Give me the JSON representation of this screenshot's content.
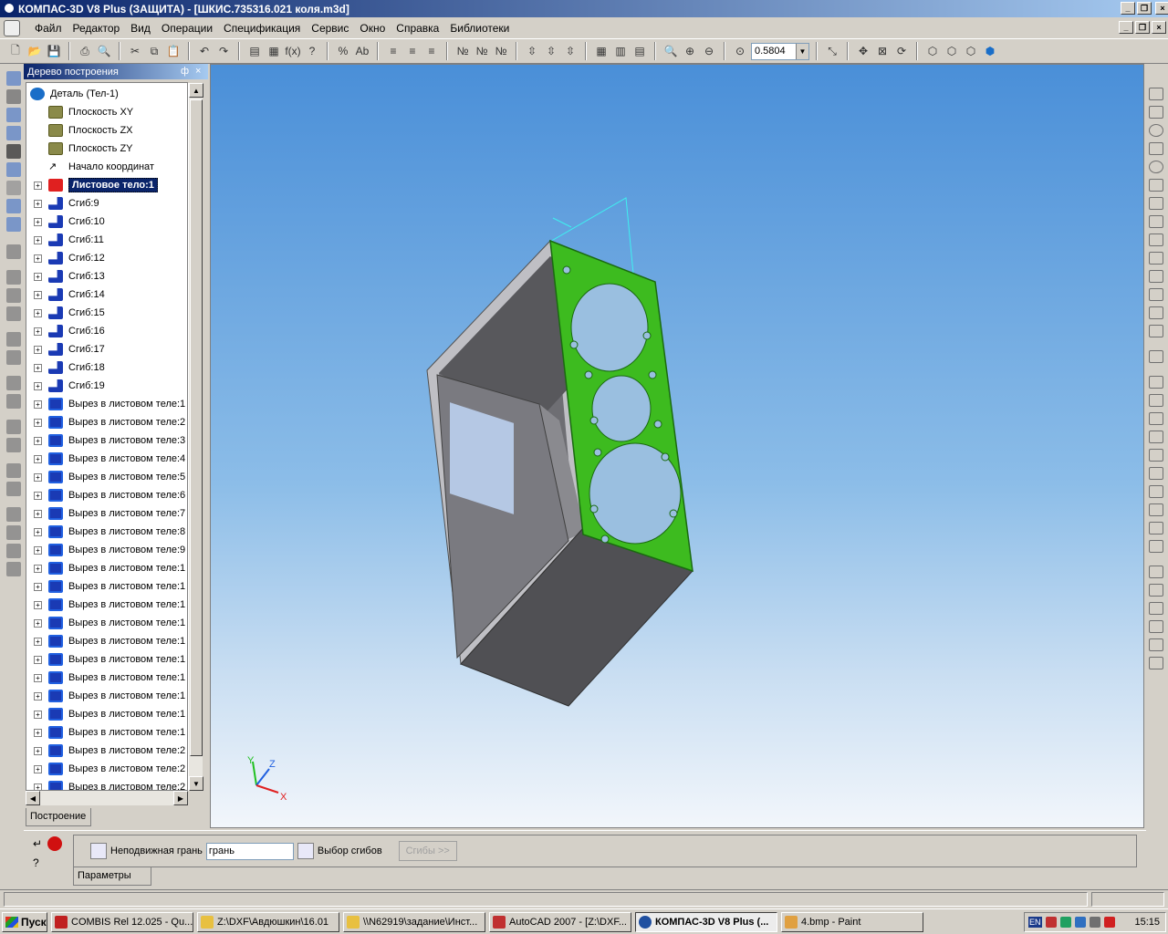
{
  "window": {
    "title": "КОМПАС-3D V8 Plus (ЗАЩИТА) - [ШКИС.735316.021 коля.m3d]"
  },
  "menu": [
    "Файл",
    "Редактор",
    "Вид",
    "Операции",
    "Спецификация",
    "Сервис",
    "Окно",
    "Справка",
    "Библиотеки"
  ],
  "toolbar": {
    "zoom_value": "0.5804"
  },
  "tree": {
    "title": "Дерево построения",
    "pin": "ф",
    "close": "×",
    "root": "Деталь (Тел-1)",
    "items": [
      {
        "label": "Плоскость XY",
        "icon": "plane-icon",
        "expandable": false
      },
      {
        "label": "Плоскость ZX",
        "icon": "plane-icon",
        "expandable": false
      },
      {
        "label": "Плоскость ZY",
        "icon": "plane-icon",
        "expandable": false
      },
      {
        "label": "Начало координат",
        "icon": "origin-icon",
        "expandable": false
      },
      {
        "label": "Листовое тело:1",
        "icon": "sheet-body-icon",
        "expandable": true,
        "selected": true
      },
      {
        "label": "Сгиб:9",
        "icon": "bend-icon",
        "expandable": true
      },
      {
        "label": "Сгиб:10",
        "icon": "bend-icon",
        "expandable": true
      },
      {
        "label": "Сгиб:11",
        "icon": "bend-icon",
        "expandable": true
      },
      {
        "label": "Сгиб:12",
        "icon": "bend-icon",
        "expandable": true
      },
      {
        "label": "Сгиб:13",
        "icon": "bend-icon",
        "expandable": true
      },
      {
        "label": "Сгиб:14",
        "icon": "bend-icon",
        "expandable": true
      },
      {
        "label": "Сгиб:15",
        "icon": "bend-icon",
        "expandable": true
      },
      {
        "label": "Сгиб:16",
        "icon": "bend-icon",
        "expandable": true
      },
      {
        "label": "Сгиб:17",
        "icon": "bend-icon",
        "expandable": true
      },
      {
        "label": "Сгиб:18",
        "icon": "bend-icon",
        "expandable": true
      },
      {
        "label": "Сгиб:19",
        "icon": "bend-icon",
        "expandable": true
      },
      {
        "label": "Вырез в листовом теле:1",
        "icon": "sheet-cut-icon",
        "expandable": true
      },
      {
        "label": "Вырез в листовом теле:2",
        "icon": "sheet-cut-icon",
        "expandable": true
      },
      {
        "label": "Вырез в листовом теле:3",
        "icon": "sheet-cut-icon",
        "expandable": true
      },
      {
        "label": "Вырез в листовом теле:4",
        "icon": "sheet-cut-icon",
        "expandable": true
      },
      {
        "label": "Вырез в листовом теле:5",
        "icon": "sheet-cut-icon",
        "expandable": true
      },
      {
        "label": "Вырез в листовом теле:6",
        "icon": "sheet-cut-icon",
        "expandable": true
      },
      {
        "label": "Вырез в листовом теле:7",
        "icon": "sheet-cut-icon",
        "expandable": true
      },
      {
        "label": "Вырез в листовом теле:8",
        "icon": "sheet-cut-icon",
        "expandable": true
      },
      {
        "label": "Вырез в листовом теле:9",
        "icon": "sheet-cut-icon",
        "expandable": true
      },
      {
        "label": "Вырез в листовом теле:1",
        "icon": "sheet-cut-icon",
        "expandable": true
      },
      {
        "label": "Вырез в листовом теле:1",
        "icon": "sheet-cut-icon",
        "expandable": true
      },
      {
        "label": "Вырез в листовом теле:1",
        "icon": "sheet-cut-icon",
        "expandable": true
      },
      {
        "label": "Вырез в листовом теле:1",
        "icon": "sheet-cut-icon",
        "expandable": true
      },
      {
        "label": "Вырез в листовом теле:1",
        "icon": "sheet-cut-icon",
        "expandable": true
      },
      {
        "label": "Вырез в листовом теле:1",
        "icon": "sheet-cut-icon",
        "expandable": true
      },
      {
        "label": "Вырез в листовом теле:1",
        "icon": "sheet-cut-icon",
        "expandable": true
      },
      {
        "label": "Вырез в листовом теле:1",
        "icon": "sheet-cut-icon",
        "expandable": true
      },
      {
        "label": "Вырез в листовом теле:1",
        "icon": "sheet-cut-icon",
        "expandable": true
      },
      {
        "label": "Вырез в листовом теле:1",
        "icon": "sheet-cut-icon",
        "expandable": true
      },
      {
        "label": "Вырез в листовом теле:2",
        "icon": "sheet-cut-icon",
        "expandable": true
      },
      {
        "label": "Вырез в листовом теле:2",
        "icon": "sheet-cut-icon",
        "expandable": true
      },
      {
        "label": "Вырез в листовом теле:2",
        "icon": "sheet-cut-icon",
        "expandable": true
      }
    ],
    "tab": "Построение"
  },
  "axes": {
    "x": "X",
    "y": "Y",
    "z": "Z"
  },
  "params": {
    "fixed_face_label": "Неподвижная грань",
    "fixed_face_value": "грань",
    "bends_select_label": "Выбор сгибов",
    "bends_button": "Сгибы >>",
    "tab": "Параметры"
  },
  "taskbar": {
    "start": "Пуск",
    "tasks": [
      {
        "label": "COMBIS Rel 12.025 - Qu...",
        "color": "#c02020"
      },
      {
        "label": "Z:\\DXF\\Авдюшкин\\16.01",
        "color": "#e8c040"
      },
      {
        "label": "\\\\N62919\\задание\\Инст...",
        "color": "#e8c040"
      },
      {
        "label": "AutoCAD 2007 - [Z:\\DXF...",
        "color": "#c03030"
      },
      {
        "label": "КОМПАС-3D V8 Plus (...",
        "color": "#2050a0",
        "active": true
      },
      {
        "label": "4.bmp - Paint",
        "color": "#e0a040"
      }
    ],
    "tray_lang": "EN",
    "clock": "15:15"
  },
  "colors": {
    "accent": "#0a246a",
    "viewport_top": "#4a8fd8",
    "selected_face": "#3dbb1f",
    "body": "#6c6c70"
  }
}
